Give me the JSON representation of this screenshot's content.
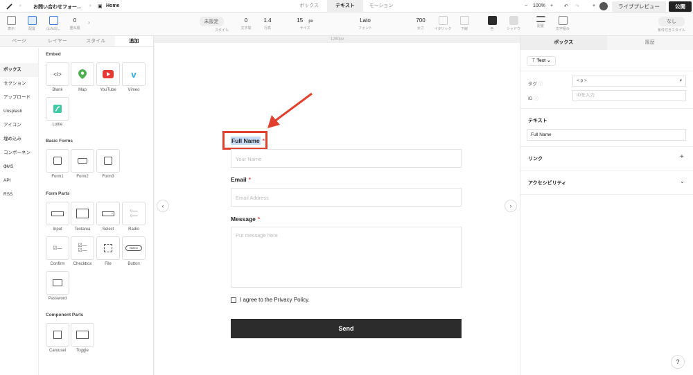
{
  "topbar": {
    "breadcrumb_project": "お問い合わせフォー...",
    "breadcrumb_page": "Home",
    "mode_tabs": [
      "ボックス",
      "テキスト",
      "モーション"
    ],
    "active_mode": "テキスト",
    "zoom": "100%",
    "preview_label": "ライブプレビュー",
    "publish_label": "公開"
  },
  "toolbar": {
    "display_label": "表示",
    "layout_label": "配置",
    "overflow_label": "はみ出し",
    "order_label": "重ね順",
    "order_value": "0",
    "style_value": "未設定",
    "style_label": "スタイル",
    "letter_spacing_value": "0",
    "letter_spacing_label": "文字間",
    "line_height_value": "1.4",
    "line_height_label": "行高",
    "size_value": "15",
    "size_unit": "px",
    "size_label": "サイズ",
    "font_value": "Lato",
    "font_label": "フォント",
    "weight_value": "700",
    "weight_label": "太さ",
    "italic_label": "イタリック",
    "underline_label": "下線",
    "color_label": "色",
    "shadow_label": "シャドウ",
    "align_label": "配置",
    "text_wrap_label": "文字組み",
    "conditional_value": "なし",
    "conditional_label": "条件付きスタイル",
    "text_color": "#2c2c2c"
  },
  "left_panel": {
    "tabs": [
      "ページ",
      "レイヤー",
      "スタイル",
      "追加"
    ],
    "active_tab": "追加",
    "categories": [
      "ボックス",
      "セクション",
      "アップロード",
      "Unsplash",
      "アイコン",
      "埋め込み",
      "コンポーネント",
      "CMS",
      "API",
      "RSS"
    ],
    "sections": {
      "embed": {
        "title": "Embed",
        "items": [
          "Blank",
          "Map",
          "YouTube",
          "Vimeo",
          "Lottie"
        ]
      },
      "basic_forms": {
        "title": "Basic Forms",
        "items": [
          "Form1",
          "Form2",
          "Form3"
        ]
      },
      "form_parts": {
        "title": "Form Parts",
        "items": [
          "Input",
          "Textarea",
          "Select",
          "Radio",
          "Confirm",
          "Checkbox",
          "File",
          "Button",
          "Password"
        ]
      },
      "component_parts": {
        "title": "Component Parts",
        "items": [
          "Carousel",
          "Toggle"
        ]
      }
    }
  },
  "canvas": {
    "ruler_label": "1280px",
    "form": {
      "full_name_label": "Full Name",
      "full_name_placeholder": "Your Name",
      "email_label": "Email",
      "email_placeholder": "Email Address",
      "message_label": "Message",
      "message_placeholder": "Put message here",
      "required_mark": "*",
      "agree_text": "I agree to the Privacy Policy.",
      "submit_label": "Send"
    },
    "highlight_color": "#e0402e"
  },
  "right_panel": {
    "tabs": [
      "ボックス",
      "履歴"
    ],
    "active_tab": "ボックス",
    "element_type": "Text",
    "tag_label": "タグ",
    "tag_value": "< p >",
    "id_label": "ID",
    "id_placeholder": "IDを入力",
    "text_section_title": "テキスト",
    "text_value": "Full Name",
    "link_title": "リンク",
    "accessibility_title": "アクセシビリティ"
  },
  "help_label": "?",
  "button_label_in_tile": "Button"
}
